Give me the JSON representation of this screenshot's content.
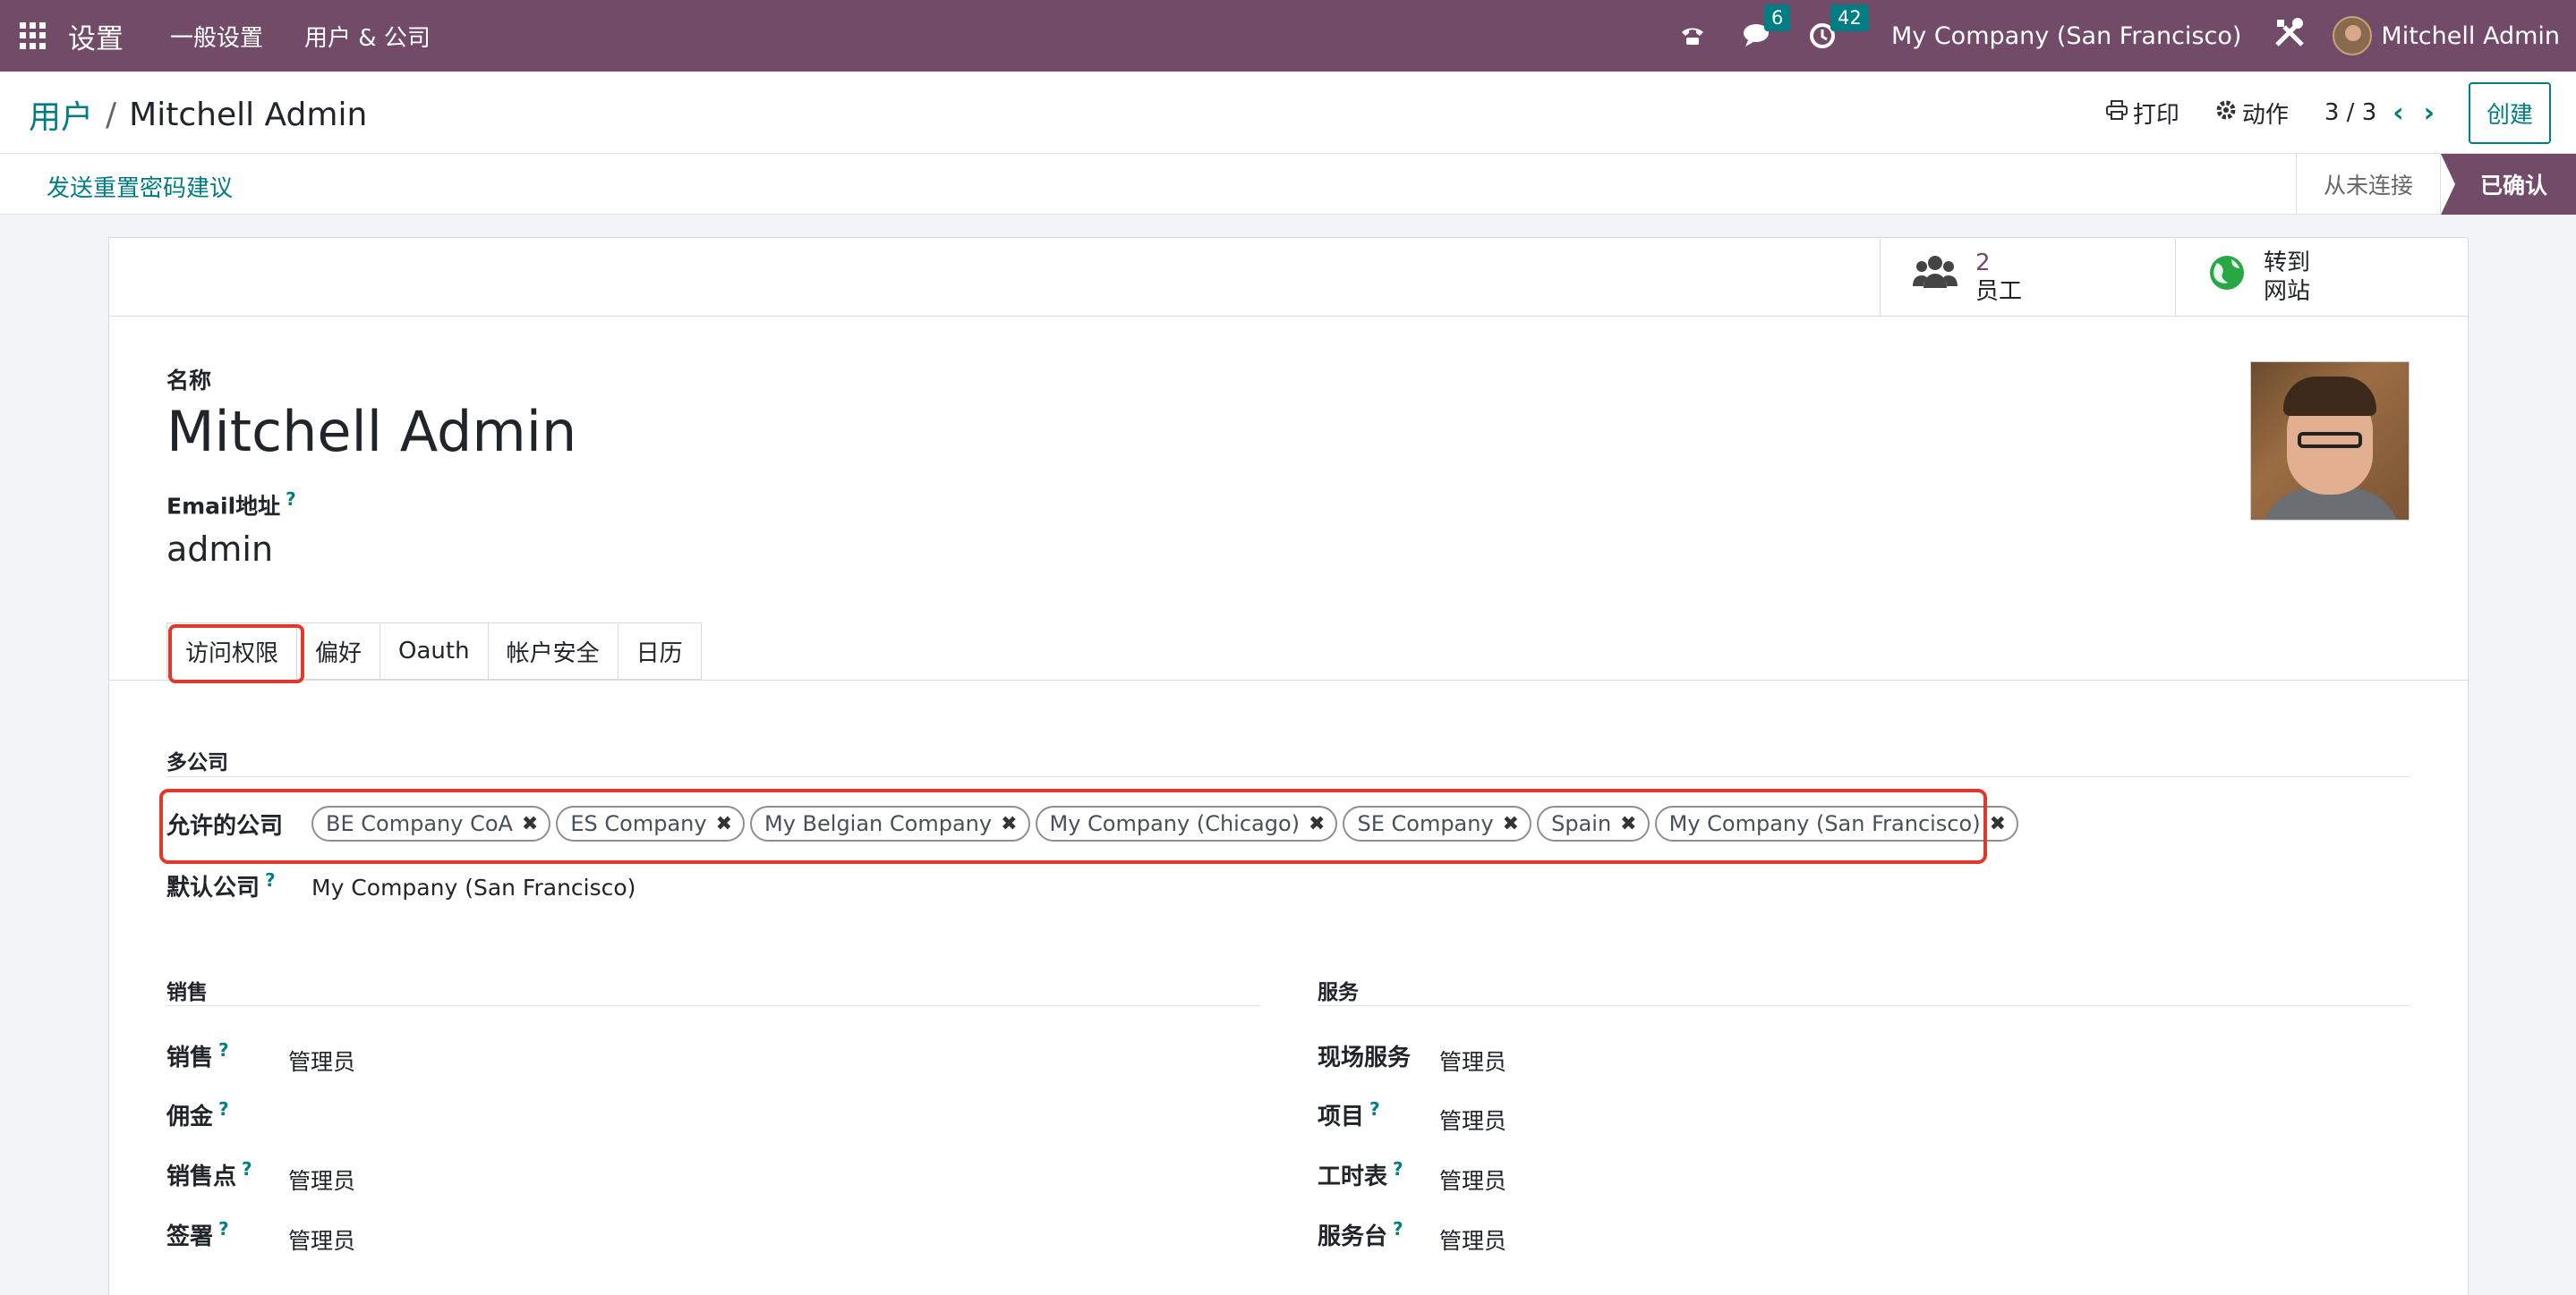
{
  "topnav": {
    "app_title": "设置",
    "menus": [
      "一般设置",
      "用户 & 公司"
    ],
    "chat_count": "6",
    "activity_count": "42",
    "company": "My Company (San Francisco)",
    "user": "Mitchell Admin"
  },
  "control_panel": {
    "breadcrumb_parent": "用户",
    "breadcrumb_sep": "/",
    "breadcrumb_current": "Mitchell Admin",
    "print_label": "打印",
    "action_label": "动作",
    "pager": "3 / 3",
    "create_label": "创建"
  },
  "statusbar": {
    "reset_password": "发送重置密码建议",
    "stages": [
      "从未连接",
      "已确认"
    ]
  },
  "stat_buttons": {
    "employees_value": "2",
    "employees_label": "员工",
    "website_line1": "转到",
    "website_line2": "网站"
  },
  "form": {
    "name_label": "名称",
    "name_value": "Mitchell Admin",
    "email_label": "Email地址",
    "email_value": "admin",
    "help_mark": "?"
  },
  "tabs": [
    "访问权限",
    "偏好",
    "Oauth",
    "帐户安全",
    "日历"
  ],
  "multi_company": {
    "section": "多公司",
    "allowed_label": "允许的公司",
    "companies": [
      "BE Company CoA",
      "ES Company",
      "My Belgian Company",
      "My Company (Chicago)",
      "SE Company",
      "Spain",
      "My Company (San Francisco)"
    ],
    "default_label": "默认公司",
    "default_value": "My Company (San Francisco)"
  },
  "sales": {
    "section": "销售",
    "rows": [
      {
        "label": "销售",
        "value": "管理员"
      },
      {
        "label": "佣金",
        "value": ""
      },
      {
        "label": "销售点",
        "value": "管理员"
      },
      {
        "label": "签署",
        "value": "管理员"
      }
    ]
  },
  "services": {
    "section": "服务",
    "rows": [
      {
        "label": "现场服务",
        "value": "管理员"
      },
      {
        "label": "项目",
        "value": "管理员"
      },
      {
        "label": "工时表",
        "value": "管理员"
      },
      {
        "label": "服务台",
        "value": "管理员"
      }
    ]
  },
  "colors": {
    "brand": "#714b67",
    "accent": "#017e84",
    "highlight": "#e0392c"
  },
  "icons": [
    "apps-grid-icon",
    "phone-icon",
    "chat-icon",
    "clock-icon",
    "tools-icon",
    "print-icon",
    "gear-icon",
    "chevron-left-icon",
    "chevron-right-icon",
    "users-icon",
    "globe-icon",
    "remove-tag-icon"
  ]
}
